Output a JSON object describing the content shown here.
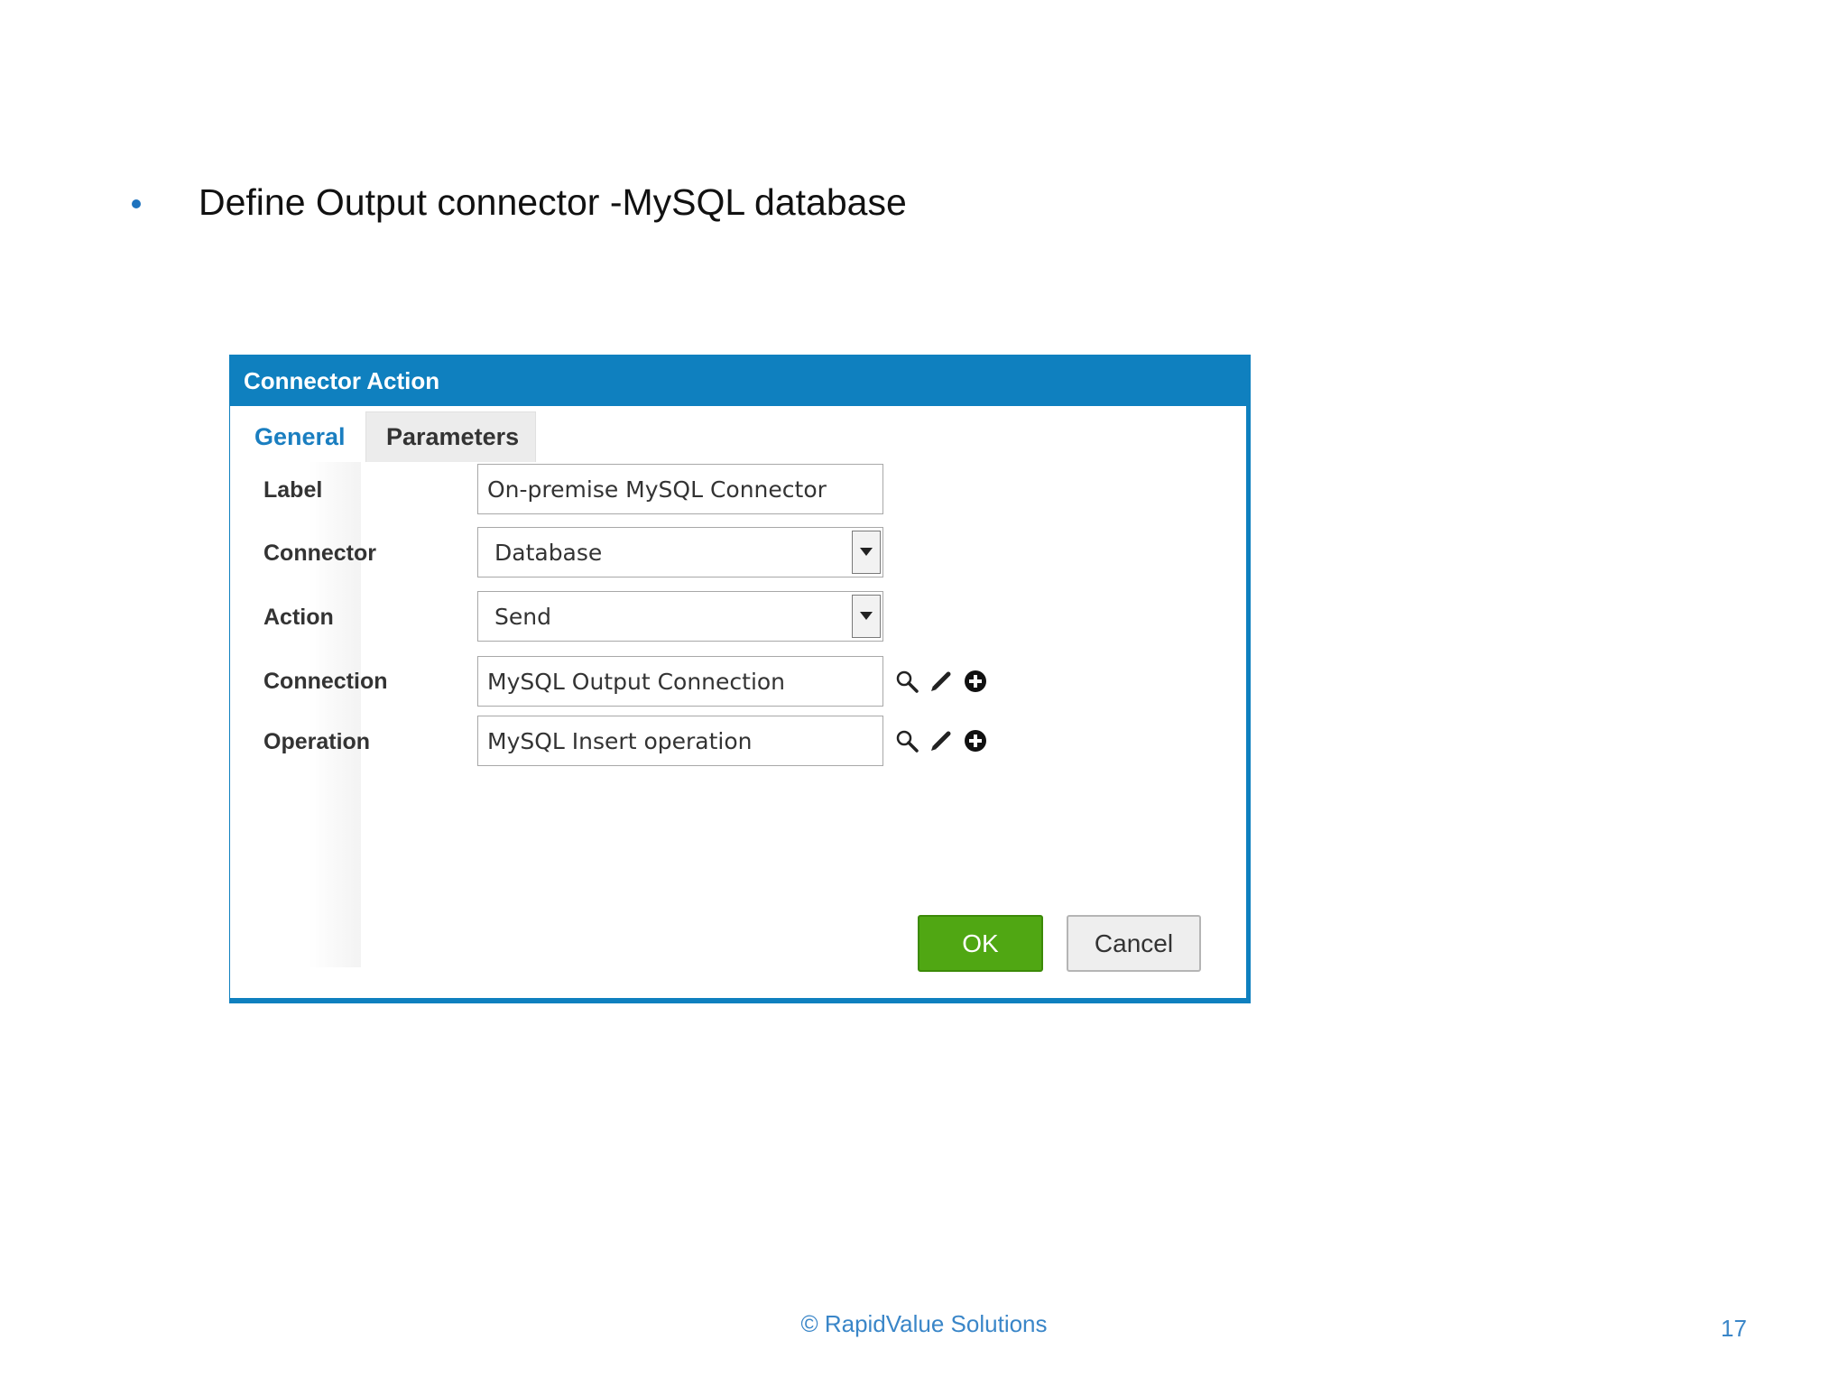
{
  "slide": {
    "bullet_text": "Define Output connector -MySQL database",
    "footer": "© RapidValue Solutions",
    "page_number": "17"
  },
  "dialog": {
    "title": "Connector Action",
    "tabs": [
      {
        "label": "General",
        "active": true
      },
      {
        "label": "Parameters",
        "active": false
      }
    ],
    "fields": {
      "label": {
        "label": "Label",
        "value": "On-premise MySQL Connector"
      },
      "connector": {
        "label": "Connector",
        "value": "Database"
      },
      "action": {
        "label": "Action",
        "value": "Send"
      },
      "connection": {
        "label": "Connection",
        "value": "MySQL Output Connection"
      },
      "operation": {
        "label": "Operation",
        "value": "MySQL Insert operation"
      }
    },
    "buttons": {
      "ok": "OK",
      "cancel": "Cancel"
    }
  },
  "colors": {
    "header": "#0f80bf",
    "active_tab": "#1a7ec0",
    "ok_button": "#50a713",
    "footer_text": "#3a86c8"
  },
  "icons": [
    "search-icon",
    "edit-icon",
    "add-icon",
    "chevron-down-icon"
  ]
}
